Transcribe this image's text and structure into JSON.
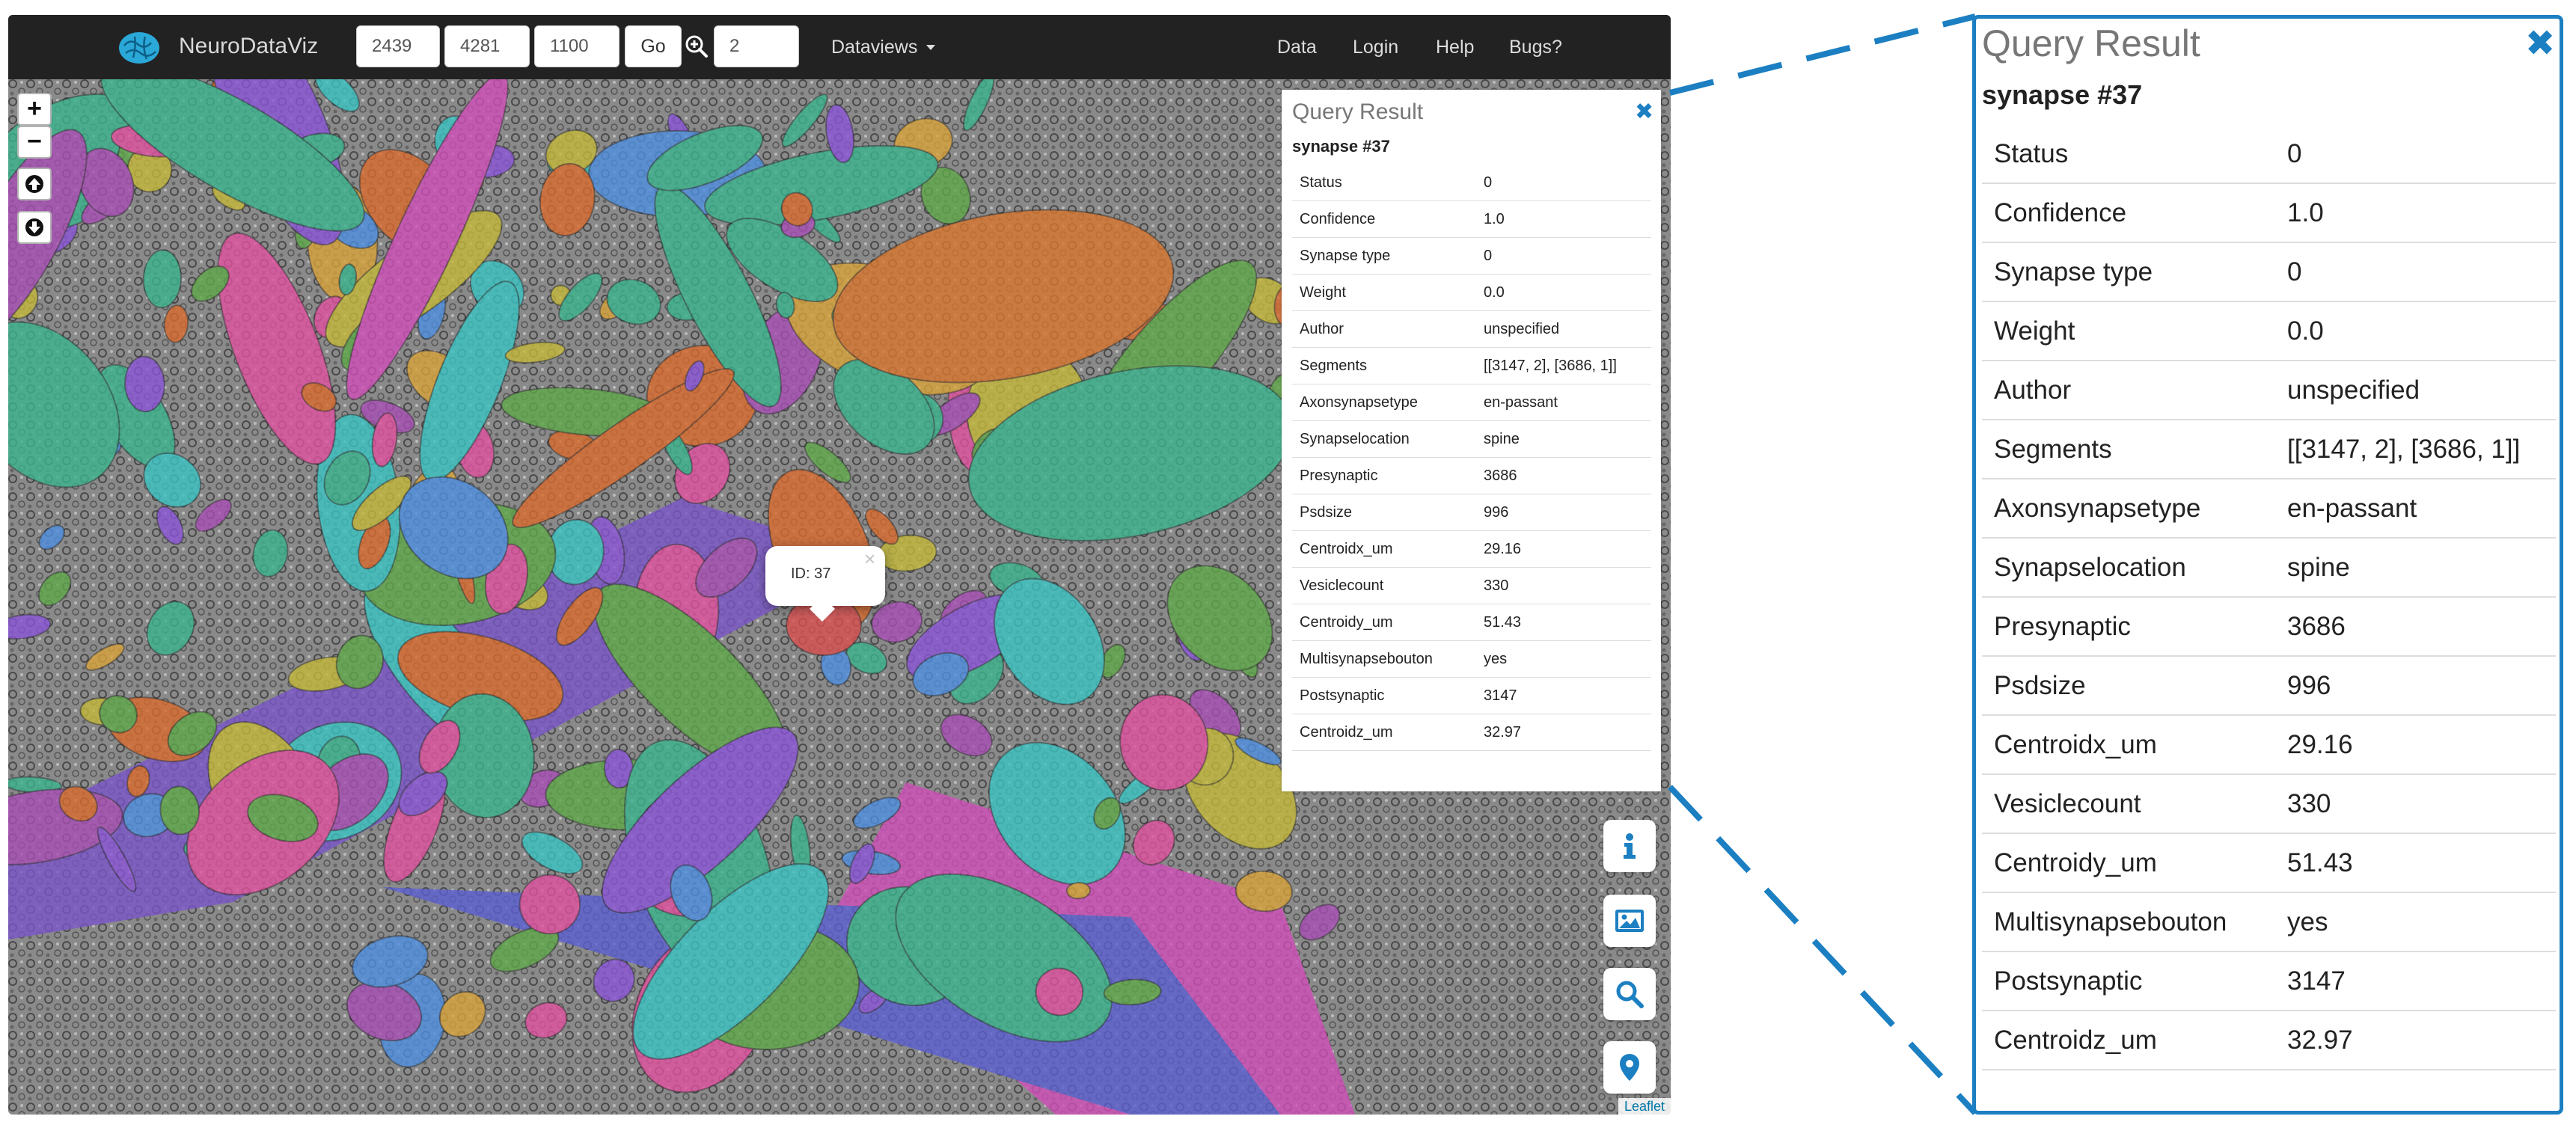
{
  "navbar": {
    "brand": "NeuroDataViz",
    "coord_x": "2439",
    "coord_y": "4281",
    "coord_z": "1100",
    "go_label": "Go",
    "zoom_level": "2",
    "dataviews_label": "Dataviews",
    "links": [
      "Data",
      "Login",
      "Help",
      "Bugs?"
    ]
  },
  "map_controls": {
    "zoom_in": "+",
    "zoom_out": "−"
  },
  "popup": {
    "text": "ID: 37",
    "close": "×"
  },
  "query_result": {
    "title": "Query Result",
    "close": "✖",
    "subtitle": "synapse #37",
    "rows": [
      {
        "key": "Status",
        "value": "0"
      },
      {
        "key": "Confidence",
        "value": "1.0"
      },
      {
        "key": "Synapse type",
        "value": "0"
      },
      {
        "key": "Weight",
        "value": "0.0"
      },
      {
        "key": "Author",
        "value": "unspecified"
      },
      {
        "key": "Segments",
        "value": "[[3147, 2], [3686, 1]]"
      },
      {
        "key": "Axonsynapsetype",
        "value": "en-passant"
      },
      {
        "key": "Synapselocation",
        "value": "spine"
      },
      {
        "key": "Presynaptic",
        "value": "3686"
      },
      {
        "key": "Psdsize",
        "value": "996"
      },
      {
        "key": "Centroidx_um",
        "value": "29.16"
      },
      {
        "key": "Vesiclecount",
        "value": "330"
      },
      {
        "key": "Centroidy_um",
        "value": "51.43"
      },
      {
        "key": "Multisynapsebouton",
        "value": "yes"
      },
      {
        "key": "Postsynaptic",
        "value": "3147"
      },
      {
        "key": "Centroidz_um",
        "value": "32.97"
      }
    ]
  },
  "attribution": "Leaflet",
  "colors": {
    "navbar_bg": "#222222",
    "accent": "#1c7fc2",
    "segment_palette": [
      "#e0509f",
      "#3bb38e",
      "#8a56d8",
      "#d9a33a",
      "#5fa84a",
      "#d96b2e",
      "#4e8fe0",
      "#a84fb5",
      "#c4b83a",
      "#3bc4c4"
    ]
  },
  "icons": [
    "brain-logo-icon",
    "zoom-in-icon",
    "caret-down-icon",
    "arrow-up-icon",
    "arrow-down-icon",
    "info-icon",
    "image-icon",
    "search-icon",
    "map-marker-icon",
    "close-icon"
  ]
}
